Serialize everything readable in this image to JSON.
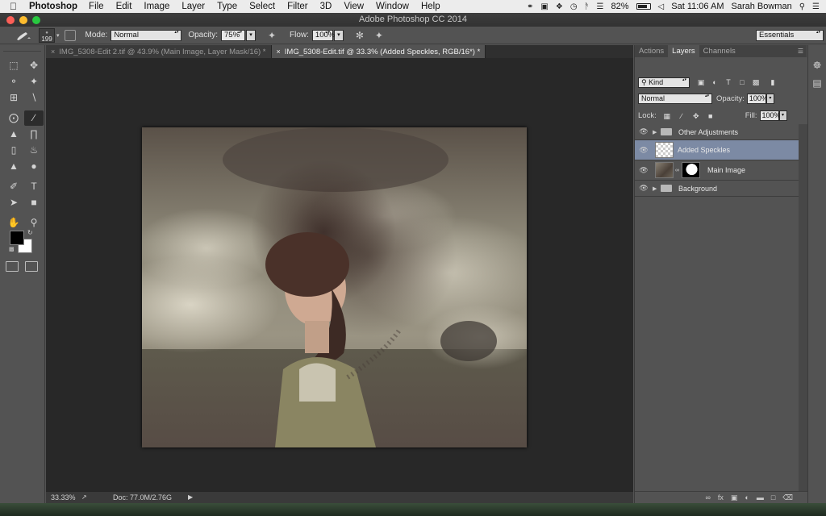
{
  "menubar": {
    "app_name": "Photoshop",
    "items": [
      "File",
      "Edit",
      "Image",
      "Layer",
      "Type",
      "Select",
      "Filter",
      "3D",
      "View",
      "Window",
      "Help"
    ],
    "battery": "82%",
    "battery_level": 0.82,
    "clock": "Sat 11:06 AM",
    "user": "Sarah Bowman"
  },
  "window": {
    "title": "Adobe Photoshop CC 2014"
  },
  "options_bar": {
    "brush_size": "199",
    "mode_label": "Mode:",
    "mode_value": "Normal",
    "opacity_label": "Opacity:",
    "opacity_value": "75%",
    "flow_label": "Flow:",
    "flow_value": "100%",
    "workspace": "Essentials"
  },
  "tabs": [
    {
      "label": "IMG_5308-Edit 2.tif @ 43.9% (Main Image, Layer Mask/16) *",
      "active": false
    },
    {
      "label": "IMG_5308-Edit.tif @ 33.3% (Added Speckles, RGB/16*) *",
      "active": true
    }
  ],
  "toolbox": {
    "foreground_color": "#000000",
    "background_color": "#ffffff"
  },
  "status_bar": {
    "zoom": "33.33%",
    "doc": "Doc: 77.0M/2.76G"
  },
  "panels": {
    "tabs": [
      "Actions",
      "Layers",
      "Channels"
    ],
    "active_tab": "Layers",
    "filter_kind": "Kind",
    "blend_mode": "Normal",
    "opacity_label": "Opacity:",
    "opacity_value": "100%",
    "lock_label": "Lock:",
    "fill_label": "Fill:",
    "fill_value": "100%",
    "layers": [
      {
        "name": "Other Adjustments",
        "type": "group",
        "visible": true,
        "selected": false
      },
      {
        "name": "Added Speckles",
        "type": "layer",
        "visible": true,
        "selected": true
      },
      {
        "name": "Main Image",
        "type": "masked-layer",
        "visible": true,
        "selected": false
      },
      {
        "name": "Background",
        "type": "group",
        "visible": true,
        "selected": false
      }
    ]
  }
}
